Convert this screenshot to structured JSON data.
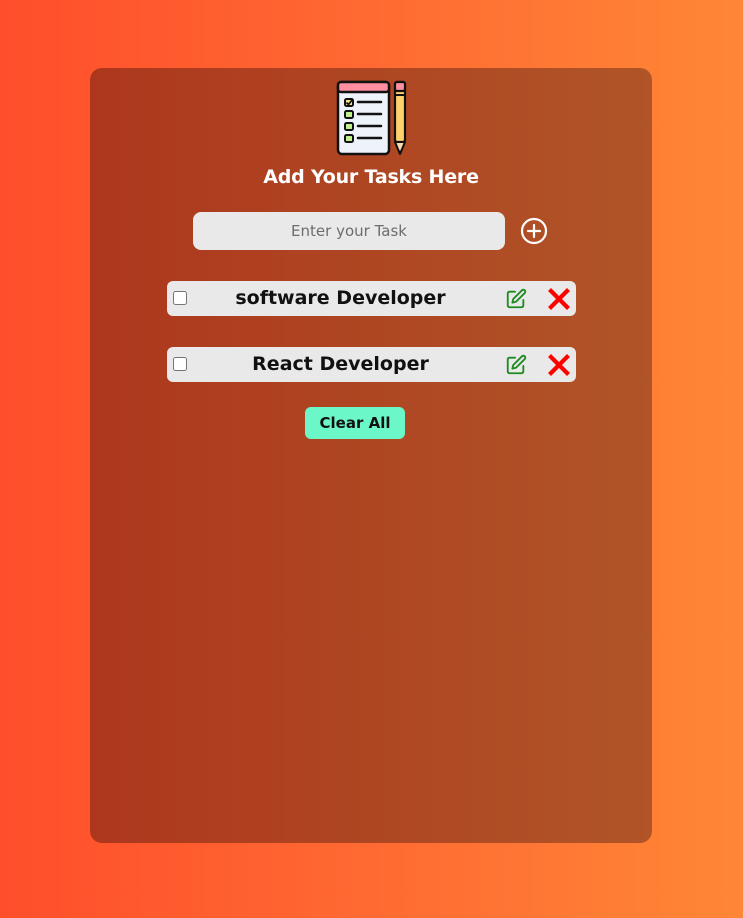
{
  "header": {
    "title": "Add Your Tasks Here",
    "logo_icon": "notepad-checklist-pencil-icon"
  },
  "input": {
    "placeholder": "Enter your Task",
    "value": "",
    "add_icon": "plus-circle-icon"
  },
  "tasks": [
    {
      "text": "software Developer",
      "checked": false,
      "edit_icon": "edit-icon",
      "delete_icon": "close-icon"
    },
    {
      "text": "React Developer",
      "checked": false,
      "edit_icon": "edit-icon",
      "delete_icon": "close-icon"
    }
  ],
  "actions": {
    "clear_label": "Clear All"
  },
  "colors": {
    "background_start": "#ff4e2b",
    "background_end": "#ff8736",
    "card": "#ad371d",
    "clear_button": "#6cf7c8",
    "edit_icon": "#1f8a1f",
    "delete_icon": "#ff0000"
  }
}
